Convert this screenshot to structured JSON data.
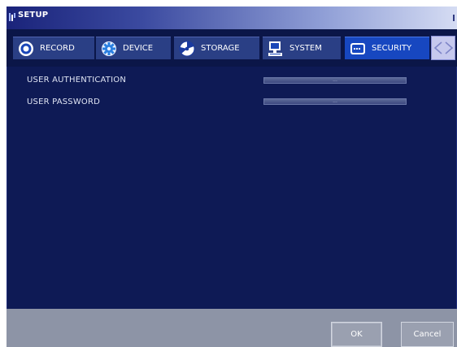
{
  "window": {
    "title": "SETUP"
  },
  "tabs": [
    {
      "label": "RECORD",
      "icon": "record-icon",
      "active": false
    },
    {
      "label": "DEVICE",
      "icon": "device-gear-icon",
      "active": false
    },
    {
      "label": "STORAGE",
      "icon": "storage-disk-icon",
      "active": false
    },
    {
      "label": "SYSTEM",
      "icon": "system-computer-icon",
      "active": false
    },
    {
      "label": "SECURITY",
      "icon": "security-icon",
      "active": true
    }
  ],
  "settings": [
    {
      "label": "USER AUTHENTICATION",
      "value": "..."
    },
    {
      "label": "USER PASSWORD",
      "value": "..."
    }
  ],
  "footer": {
    "ok_label": "OK",
    "cancel_label": "Cancel"
  },
  "colors": {
    "background": "#0e1a55",
    "tab": "#2a3f85",
    "active_tab": "#1747c0",
    "footer": "#8d94a6"
  }
}
